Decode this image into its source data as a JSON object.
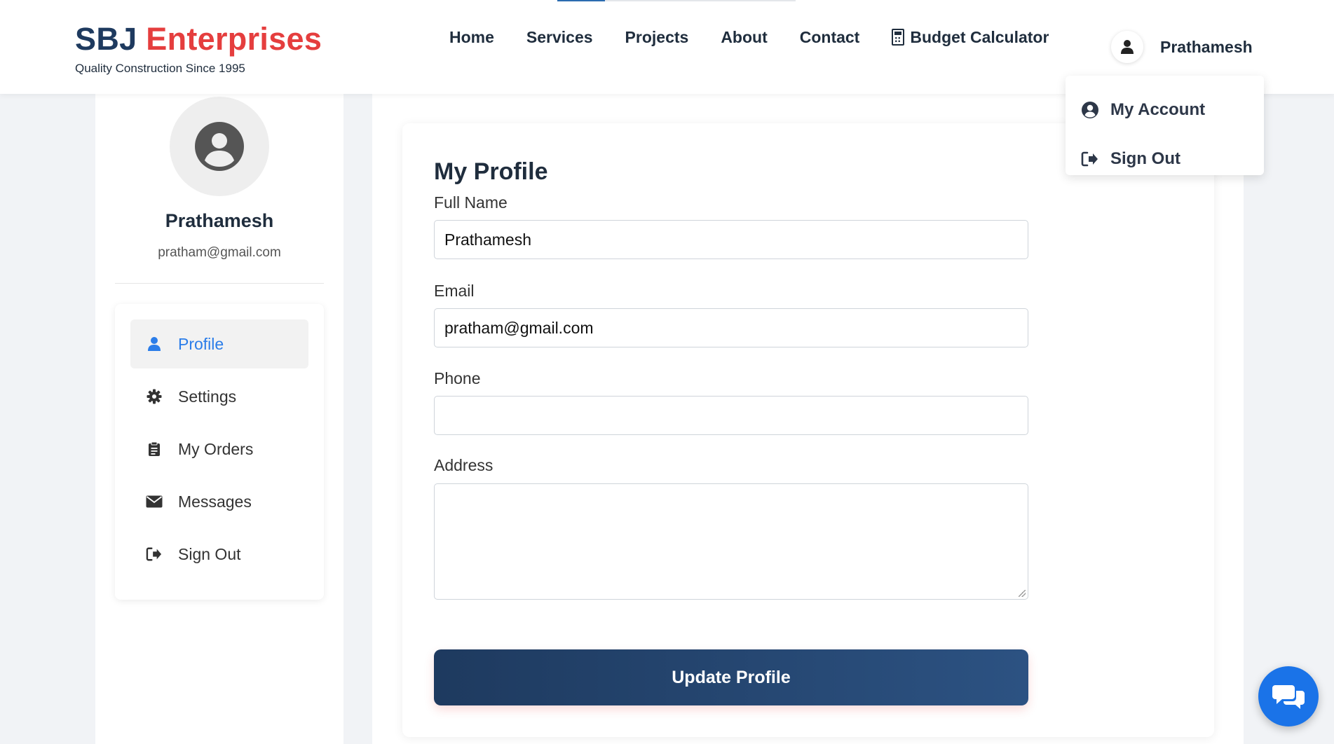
{
  "brand": {
    "name_part1": "SBJ",
    "name_part2": "Enterprises",
    "tagline": "Quality Construction Since 1995",
    "color_primary": "#1e3a5f",
    "color_accent": "#e53e3e"
  },
  "nav": {
    "items": [
      {
        "label": "Home"
      },
      {
        "label": "Services"
      },
      {
        "label": "Projects"
      },
      {
        "label": "About"
      },
      {
        "label": "Contact"
      }
    ],
    "calculator_label": "Budget Calculator",
    "calculator_icon": "calculator-icon"
  },
  "user": {
    "name": "Prathamesh",
    "email": "pratham@gmail.com",
    "icon": "user-icon"
  },
  "user_dropdown": {
    "items": [
      {
        "label": "My Account",
        "icon": "user-circle-icon"
      },
      {
        "label": "Sign Out",
        "icon": "sign-out-icon"
      }
    ]
  },
  "sidebar": {
    "menu": [
      {
        "label": "Profile",
        "icon": "user-icon",
        "active": true
      },
      {
        "label": "Settings",
        "icon": "gear-icon"
      },
      {
        "label": "My Orders",
        "icon": "clipboard-icon"
      },
      {
        "label": "Messages",
        "icon": "envelope-icon"
      },
      {
        "label": "Sign Out",
        "icon": "sign-out-icon"
      }
    ],
    "active_color": "#2b7de9"
  },
  "profile_form": {
    "title": "My Profile",
    "full_name_label": "Full Name",
    "full_name_value": "Prathamesh",
    "email_label": "Email",
    "email_value": "pratham@gmail.com",
    "phone_label": "Phone",
    "phone_value": "",
    "address_label": "Address",
    "address_value": "",
    "submit_label": "Update Profile"
  },
  "chat": {
    "icon": "chat-bubbles-icon",
    "color": "#1a73e8"
  }
}
